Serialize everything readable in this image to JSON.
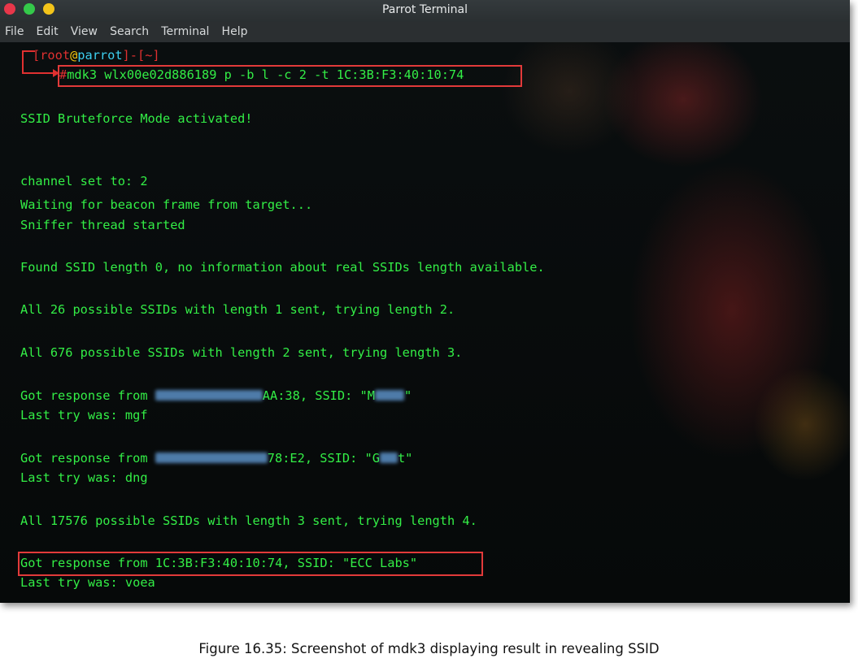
{
  "window": {
    "title": "Parrot Terminal",
    "controls": [
      "close",
      "maximize",
      "minimize"
    ],
    "colors": {
      "close": "#e8374a",
      "maximize": "#34c94a",
      "minimize": "#f3c41a"
    }
  },
  "menu": [
    "File",
    "Edit",
    "View",
    "Search",
    "Terminal",
    "Help"
  ],
  "prompt": {
    "open_bracket": "[",
    "user": "root",
    "at": "@",
    "host": "parrot",
    "mid": "]-[",
    "dir": "~",
    "close_bracket": "]",
    "hash": "#",
    "command": "mdk3 wlx00e02d886189 p -b l -c 2 -t 1C:3B:F3:40:10:74"
  },
  "output": {
    "mode": "SSID Bruteforce Mode activated!",
    "channel": "channel set to: 2",
    "waiting": "Waiting for beacon frame from target...",
    "sniffer": "Sniffer thread started",
    "found_length": "Found SSID length 0, no information about real SSIDs length available.",
    "len1": "All 26 possible SSIDs with length 1 sent, trying length 2.",
    "len2": "All 676 possible SSIDs with length 2 sent, trying length 3.",
    "resp1": {
      "prefix": "Got response from ",
      "mac_visible": "AA:38",
      "ssid_prefix": ", SSID: \"M",
      "ssid_suffix": "\""
    },
    "try1": "Last try was: mgf",
    "resp2": {
      "prefix": "Got response from ",
      "mac_visible": "78:E2",
      "ssid_prefix": ", SSID: \"G",
      "ssid_suffix": "t\""
    },
    "try2": "Last try was: dng",
    "len3": "All 17576 possible SSIDs with length 3 sent, trying length 4.",
    "final_response": "Got response from 1C:3B:F3:40:10:74, SSID: \"ECC Labs\"",
    "final_try": "Last try was: voea"
  },
  "caption": "Figure 16.35: Screenshot of mdk3 displaying result in revealing SSID",
  "colors": {
    "terminal_text": "#33ee46",
    "highlight_box": "#e23a3a",
    "prompt_red": "#e03030",
    "host": "#3dd0f0",
    "at": "#f1c40f"
  }
}
